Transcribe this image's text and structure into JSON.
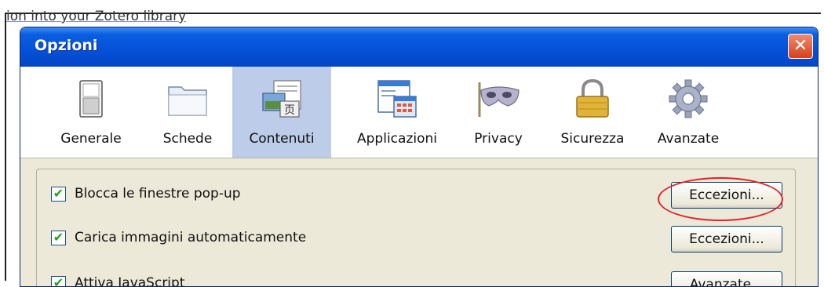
{
  "background": {
    "partial_text": "ion into your Zotero library"
  },
  "dialog": {
    "title": "Opzioni",
    "close_label": "✕"
  },
  "tabs": [
    {
      "label": "Generale",
      "icon": "general-switch-icon"
    },
    {
      "label": "Schede",
      "icon": "tabs-folder-icon"
    },
    {
      "label": "Contenuti",
      "icon": "content-icon",
      "selected": true
    },
    {
      "label": "Applicazioni",
      "icon": "applications-icon"
    },
    {
      "label": "Privacy",
      "icon": "privacy-mask-icon"
    },
    {
      "label": "Sicurezza",
      "icon": "security-lock-icon"
    },
    {
      "label": "Avanzate",
      "icon": "advanced-gear-icon"
    }
  ],
  "options": [
    {
      "label": "Blocca le finestre pop-up",
      "checked": true,
      "button": "Eccezioni..."
    },
    {
      "label": "Carica immagini automaticamente",
      "checked": true,
      "button": "Eccezioni..."
    },
    {
      "label": "Attiva JavaScript",
      "checked": true,
      "button": "Avanzate..."
    }
  ],
  "colors": {
    "titlebar": "#0450d8",
    "selected_tab": "#bccce9",
    "dialog_bg": "#ece9d8",
    "highlight": "#e0202a"
  }
}
